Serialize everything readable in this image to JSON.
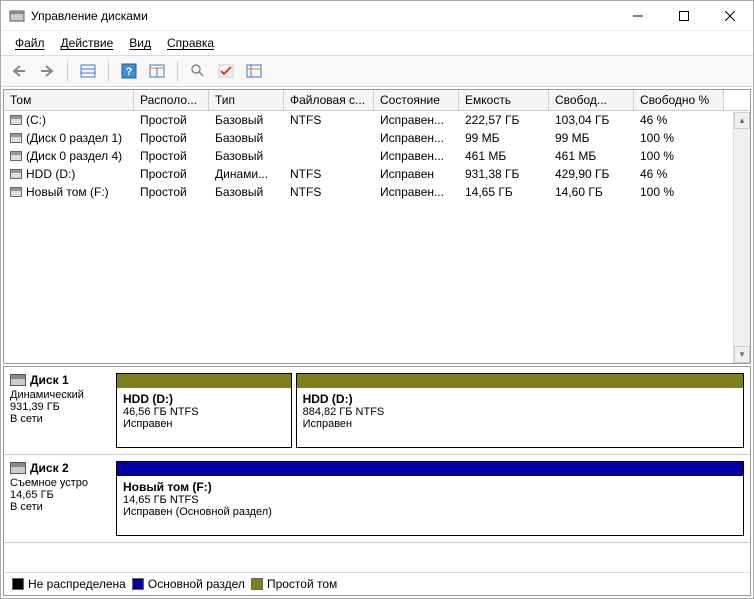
{
  "window": {
    "title": "Управление дисками"
  },
  "menu": {
    "file": "Файл",
    "action": "Действие",
    "view": "Вид",
    "help": "Справка"
  },
  "columns": {
    "volume": "Том",
    "layout": "Располо...",
    "type": "Тип",
    "filesystem": "Файловая с...",
    "status": "Состояние",
    "capacity": "Емкость",
    "free": "Свобод...",
    "freepct": "Свободно %"
  },
  "volumes": [
    {
      "name": "(C:)",
      "layout": "Простой",
      "type": "Базовый",
      "fs": "NTFS",
      "status": "Исправен...",
      "cap": "222,57 ГБ",
      "free": "103,04 ГБ",
      "pct": "46 %"
    },
    {
      "name": "(Диск 0 раздел 1)",
      "layout": "Простой",
      "type": "Базовый",
      "fs": "",
      "status": "Исправен...",
      "cap": "99 МБ",
      "free": "99 МБ",
      "pct": "100 %"
    },
    {
      "name": "(Диск 0 раздел 4)",
      "layout": "Простой",
      "type": "Базовый",
      "fs": "",
      "status": "Исправен...",
      "cap": "461 МБ",
      "free": "461 МБ",
      "pct": "100 %"
    },
    {
      "name": "HDD (D:)",
      "layout": "Простой",
      "type": "Динами...",
      "fs": "NTFS",
      "status": "Исправен",
      "cap": "931,38 ГБ",
      "free": "429,90 ГБ",
      "pct": "46 %"
    },
    {
      "name": "Новый том (F:)",
      "layout": "Простой",
      "type": "Базовый",
      "fs": "NTFS",
      "status": "Исправен...",
      "cap": "14,65 ГБ",
      "free": "14,60 ГБ",
      "pct": "100 %"
    }
  ],
  "disks": [
    {
      "label": "Диск 1",
      "type": "Динамический",
      "size": "931,39 ГБ",
      "status": "В сети",
      "parts": [
        {
          "title": "HDD  (D:)",
          "sub": "46,56 ГБ NTFS",
          "state": "Исправен",
          "color": "#807f1f",
          "flex": 28
        },
        {
          "title": "HDD  (D:)",
          "sub": "884,82 ГБ NTFS",
          "state": "Исправен",
          "color": "#807f1f",
          "flex": 72
        }
      ]
    },
    {
      "label": "Диск 2",
      "type": "Съемное устро",
      "size": "14,65 ГБ",
      "status": "В сети",
      "parts": [
        {
          "title": "Новый том  (F:)",
          "sub": "14,65 ГБ NTFS",
          "state": "Исправен (Основной раздел)",
          "color": "#0000a0",
          "flex": 55
        }
      ]
    }
  ],
  "legend": {
    "unalloc": "Не распределена",
    "primary": "Основной раздел",
    "simple": "Простой том"
  },
  "colors": {
    "unalloc": "#000000",
    "primary": "#0000a0",
    "simple": "#807f1f"
  }
}
